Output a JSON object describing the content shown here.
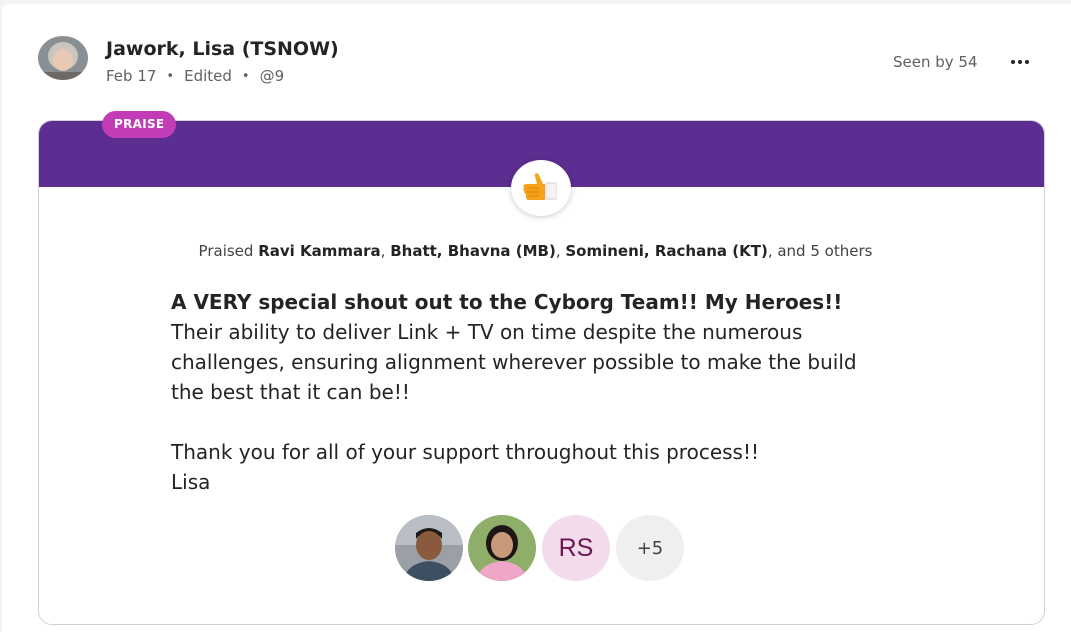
{
  "post": {
    "author_name": "Jawork, Lisa (TSNOW)",
    "date": "Feb 17",
    "edited": "Edited",
    "mention_count": "@9",
    "seen_by": "Seen by 54",
    "avatar_icon": "author-photo"
  },
  "praise": {
    "badge": "PRAISE",
    "icon": "thumbs-up-icon",
    "banner_color": "#5c2e91",
    "badge_color": "#c13cb6",
    "praised_prefix": "Praised ",
    "recipients": [
      "Ravi Kammara",
      "Bhatt, Bhavna (MB)",
      "Somineni, Rachana (KT)"
    ],
    "separator": ", ",
    "praised_suffix": ", and 5 others"
  },
  "message": {
    "headline": "A VERY special shout out to the Cyborg Team!!  My Heroes!!",
    "lines": [
      "Their ability to deliver Link + TV on time despite the numerous",
      "challenges, ensuring alignment wherever possible to make the build",
      "the best that it can be!!"
    ],
    "closing": "Thank you for all of your support throughout this process!!",
    "signature": "Lisa"
  },
  "recipient_avatars": {
    "initials": "RS",
    "more": "+5"
  }
}
